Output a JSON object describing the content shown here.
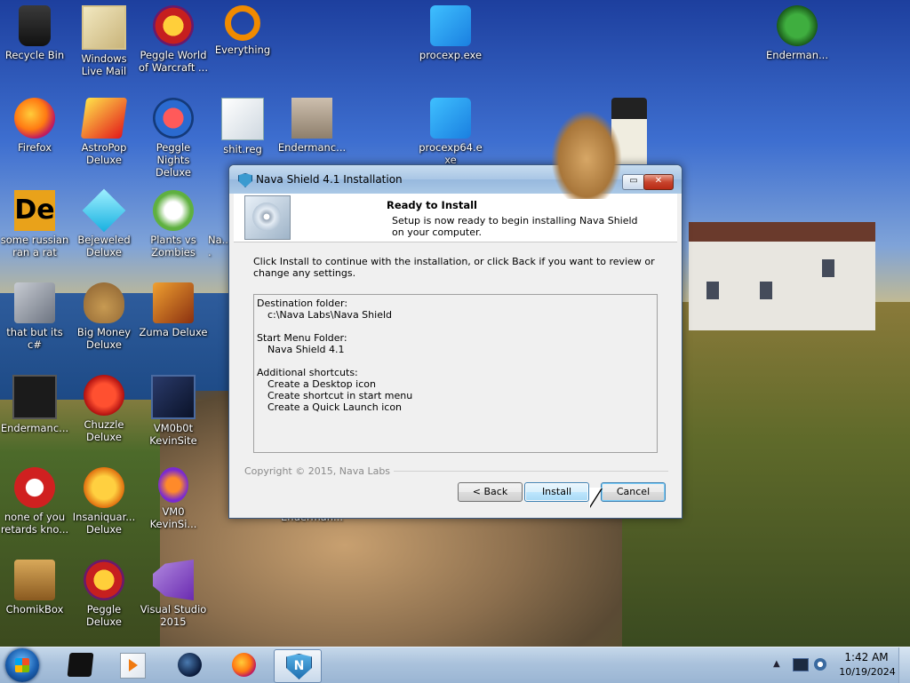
{
  "desktop": {
    "icons": [
      {
        "label": "Recycle Bin",
        "icon": "recycle-bin-icon"
      },
      {
        "label": "Windows Live Mail",
        "icon": "mail-icon"
      },
      {
        "label": "Peggle World of Warcraft ...",
        "icon": "peggle-icon"
      },
      {
        "label": "Everything",
        "icon": "search-icon"
      },
      {
        "label": "procexp.exe",
        "icon": "procexp-icon"
      },
      {
        "label": "Enderman...",
        "icon": "dragon-icon"
      },
      {
        "label": "Firefox",
        "icon": "firefox-icon"
      },
      {
        "label": "AstroPop Deluxe",
        "icon": "astropop-icon"
      },
      {
        "label": "Peggle Nights Deluxe",
        "icon": "peggle-nights-icon"
      },
      {
        "label": "shit.reg",
        "icon": "registry-file-icon"
      },
      {
        "label": "Endermanc...",
        "icon": "cat-photo-icon"
      },
      {
        "label": "procexp64.exe",
        "icon": "procexp64-icon"
      },
      {
        "label": "some russian ran a rat",
        "icon": "de-icon"
      },
      {
        "label": "Bejeweled Deluxe",
        "icon": "gem-icon"
      },
      {
        "label": "Plants vs Zombies",
        "icon": "plants-icon"
      },
      {
        "label": "Na...",
        "icon": "partial-icon"
      },
      {
        "label": "that but its c#",
        "icon": "copy-icon"
      },
      {
        "label": "Big Money Deluxe",
        "icon": "money-bag-icon"
      },
      {
        "label": "Zuma Deluxe",
        "icon": "zuma-icon"
      },
      {
        "label": "Endermanc...",
        "icon": "terminal-icon"
      },
      {
        "label": "Chuzzle Deluxe",
        "icon": "chuzzle-icon"
      },
      {
        "label": "VM0b0t KevinSite",
        "icon": "vm-icon"
      },
      {
        "label": "none of you retards kno...",
        "icon": "bird-icon"
      },
      {
        "label": "Insaniquar... Deluxe",
        "icon": "fish-icon"
      },
      {
        "label": "VM0 KevinSi...",
        "icon": "vm-firefox-icon"
      },
      {
        "label": "Enderman...",
        "icon": "hidden-icon"
      },
      {
        "label": "ChomikBox",
        "icon": "hamster-icon"
      },
      {
        "label": "Peggle Deluxe",
        "icon": "peggle-deluxe-icon"
      },
      {
        "label": "Visual Studio 2015",
        "icon": "visual-studio-icon"
      }
    ]
  },
  "dialog": {
    "title": "Nava Shield 4.1 Installation",
    "title_icon": "shield-icon",
    "restore_label": "▭",
    "close_label": "✕",
    "header_title": "Ready to Install",
    "header_subtitle": "Setup is now ready to begin installing Nava Shield on your computer.",
    "intro": "Click Install to continue with the installation, or click Back if you want to review or change any settings.",
    "summary_lines": [
      "Destination folder:",
      "c:\\Nava Labs\\Nava Shield",
      "",
      "Start Menu Folder:",
      "Nava Shield 4.1",
      "",
      "Additional shortcuts:",
      "Create a Desktop icon",
      "Create shortcut in start menu",
      "Create a Quick Launch icon"
    ],
    "copyright": "Copyright © 2015, Nava Labs",
    "back_label": "< Back",
    "install_label": "Install",
    "cancel_label": "Cancel"
  },
  "taskbar": {
    "pinned": [
      {
        "name": "black-app-icon"
      },
      {
        "name": "media-player-icon"
      },
      {
        "name": "globe-icon"
      },
      {
        "name": "firefox-icon"
      },
      {
        "name": "nava-shield-icon",
        "label": "N",
        "active": true
      }
    ],
    "tray_arrow": "▲",
    "clock_time": "1:42 AM",
    "clock_date": "10/19/2024"
  }
}
